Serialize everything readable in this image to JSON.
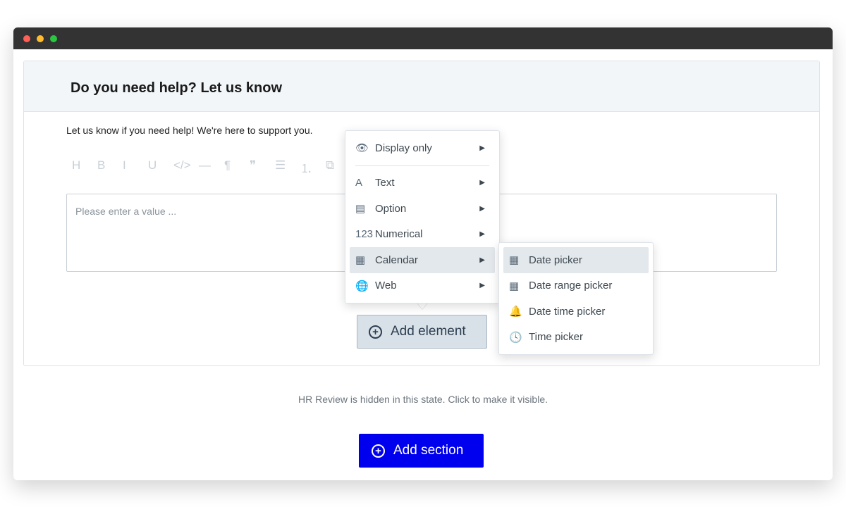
{
  "window": {
    "dots": [
      "#ff5f57",
      "#febc2e",
      "#28c840"
    ]
  },
  "card": {
    "title": "Do you need help? Let us know",
    "description": "Let us know if you need help! We're here to support you.",
    "placeholder": "Please enter a value ..."
  },
  "toolbar": [
    {
      "glyph": "H",
      "name": "heading"
    },
    {
      "glyph": "B",
      "name": "bold"
    },
    {
      "glyph": "I",
      "name": "italic"
    },
    {
      "glyph": "U",
      "name": "underline"
    },
    {
      "glyph": "</>",
      "name": "code"
    },
    {
      "glyph": "—",
      "name": "horizontal-rule"
    },
    {
      "glyph": "¶",
      "name": "paragraph"
    },
    {
      "glyph": "❞",
      "name": "quote"
    },
    {
      "glyph": "☰",
      "name": "bullet-list"
    },
    {
      "glyph": "⒈",
      "name": "numbered-list"
    },
    {
      "glyph": "⧉",
      "name": "embed"
    }
  ],
  "menu": {
    "items": [
      {
        "label": "Display only",
        "icon": "👁"
      },
      {
        "label": "Text",
        "icon": "A"
      },
      {
        "label": "Option",
        "icon": "▤"
      },
      {
        "label": "Numerical",
        "icon": "123"
      },
      {
        "label": "Calendar",
        "icon": "▦",
        "selected": true
      },
      {
        "label": "Web",
        "icon": "🌐"
      }
    ]
  },
  "submenu": {
    "items": [
      {
        "label": "Date picker",
        "icon": "▦",
        "selected": true
      },
      {
        "label": "Date range picker",
        "icon": "▦"
      },
      {
        "label": "Date time picker",
        "icon": "🔔"
      },
      {
        "label": "Time picker",
        "icon": "🕓"
      }
    ]
  },
  "add_element": "Add element",
  "hidden_note": "HR Review is hidden in this state. Click to make it visible.",
  "add_section": "Add section",
  "colors": {
    "accent": "#0000ee",
    "button_bg": "#d9e1e8"
  }
}
